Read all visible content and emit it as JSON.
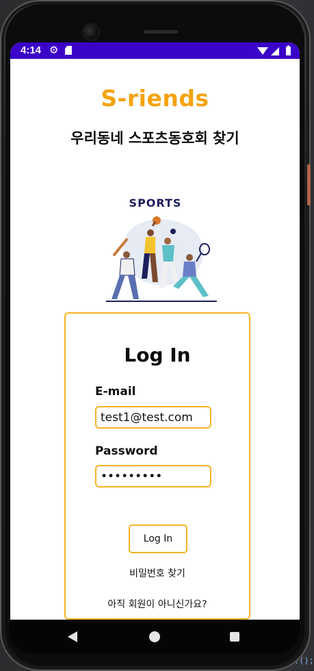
{
  "status_bar": {
    "time": "4:14",
    "settings_icon": "gear-icon",
    "sd_card_icon": "sd-card-icon",
    "wifi_icon": "wifi-icon",
    "signal_icon": "signal-icon",
    "battery_icon": "battery-icon",
    "color": "#3b04c9"
  },
  "header": {
    "title": "S-riends",
    "subtitle": "우리동네 스포츠동호회 찾기"
  },
  "illustration": {
    "caption": "SPORTS"
  },
  "login": {
    "heading": "Log In",
    "email_label": "E-mail",
    "email_value": "test1@test.com",
    "password_label": "Password",
    "password_value": "•••••••••",
    "submit_label": "Log In",
    "find_password_link": "비밀번호 찾기",
    "signup_link": "아직 회원이 아니신가요?"
  },
  "navigation": {
    "back_icon": "back-triangle-icon",
    "home_icon": "home-circle-icon",
    "recents_icon": "recents-square-icon"
  },
  "theme": {
    "accent": "#f5a30e",
    "border": "#f5b325",
    "status_bar": "#3b04c9",
    "illustration_navy": "#1b1f5c"
  },
  "corner_text": ".();"
}
